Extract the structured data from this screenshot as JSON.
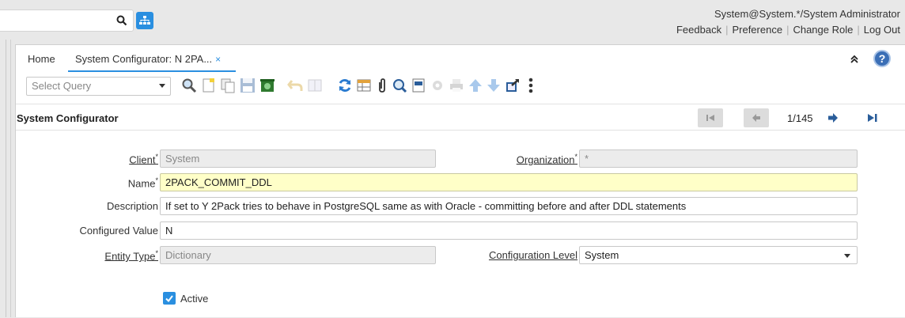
{
  "header": {
    "user": "System@System.*/System Administrator",
    "links": [
      "Feedback",
      "Preference",
      "Change Role",
      "Log Out"
    ]
  },
  "tabs": {
    "home": "Home",
    "active": "System Configurator: N 2PA...",
    "close_glyph": "×"
  },
  "toolbar": {
    "query_placeholder": "Select Query"
  },
  "section": {
    "title": "System Configurator",
    "record_count": "1/145"
  },
  "form": {
    "client": {
      "label": "Client",
      "value": "System"
    },
    "organization": {
      "label": "Organization",
      "value": "*"
    },
    "name": {
      "label": "Name",
      "value": "2PACK_COMMIT_DDL"
    },
    "description": {
      "label": "Description",
      "value": "If set to Y 2Pack tries to behave in PostgreSQL same as with Oracle - committing before and after DDL statements"
    },
    "configured_value": {
      "label": "Configured Value",
      "value": "N"
    },
    "entity_type": {
      "label": "Entity Type",
      "value": "Dictionary"
    },
    "configuration_level": {
      "label": "Configuration Level",
      "value": "System"
    },
    "active": {
      "label": "Active",
      "checked": true
    },
    "required_mark": "*"
  },
  "colors": {
    "accent": "#2a8fe0",
    "required_bg": "#ffffc8",
    "readonly_bg": "#ececec"
  }
}
